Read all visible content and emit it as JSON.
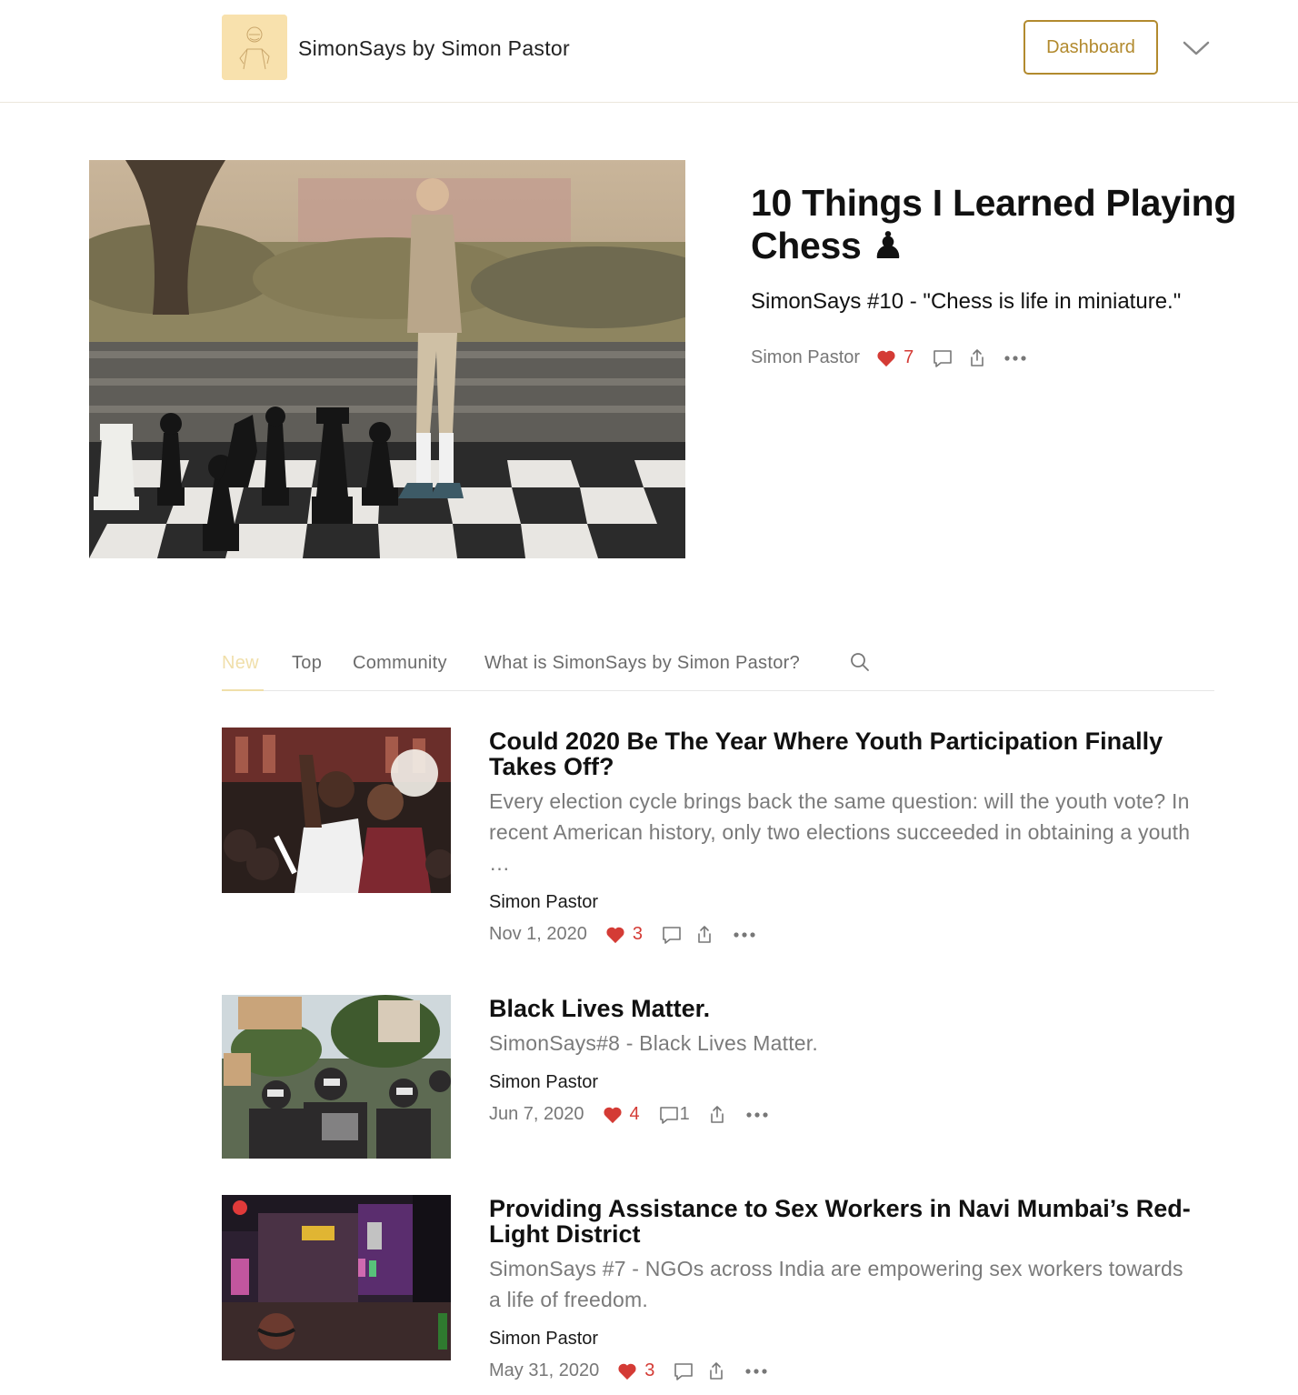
{
  "header": {
    "site_title": "SimonSays by Simon Pastor",
    "dashboard_label": "Dashboard"
  },
  "hero": {
    "title": "10 Things I Learned Playing Chess ♟",
    "subtitle": "SimonSays #10 - \"Chess is life in miniature.\"",
    "author": "Simon Pastor",
    "likes": "7"
  },
  "tabs": {
    "new": "New",
    "top": "Top",
    "community": "Community",
    "about": "What is SimonSays by Simon Pastor?"
  },
  "posts": [
    {
      "title": "Could 2020 Be The Year Where Youth Participation Finally Takes Off?",
      "subtitle": "Every election cycle brings back the same question: will the youth vote? In recent American history, only two elections succeeded in obtaining a youth …",
      "author": "Simon Pastor",
      "date": "Nov 1, 2020",
      "likes": "3",
      "comments": ""
    },
    {
      "title": "Black Lives Matter.",
      "subtitle": "SimonSays#8 - Black Lives Matter.",
      "author": "Simon Pastor",
      "date": "Jun 7, 2020",
      "likes": "4",
      "comments": "1"
    },
    {
      "title": "Providing Assistance to Sex Workers in Navi Mumbai’s Red-Light District",
      "subtitle": "SimonSays #7 - NGOs across India are empowering sex workers towards a life of freedom.",
      "author": "Simon Pastor",
      "date": "May 31, 2020",
      "likes": "3",
      "comments": ""
    }
  ],
  "colors": {
    "accent": "#b28a2e",
    "tab_active": "#f0dfaa",
    "heart": "#d43b35",
    "logo_bg": "#f8e1ad"
  },
  "icons": [
    "heart-icon",
    "comment-icon",
    "share-icon",
    "more-icon",
    "search-icon",
    "chevron-down-icon"
  ]
}
